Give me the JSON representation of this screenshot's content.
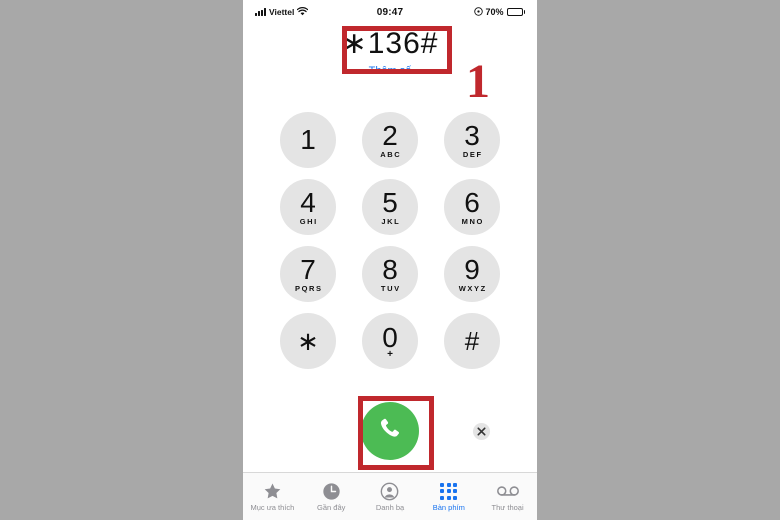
{
  "status_bar": {
    "carrier": "Viettel",
    "time": "09:47",
    "battery_percent": "70%",
    "signal_icon": "signal-bars-icon",
    "wifi_icon": "wifi-icon",
    "alarm_icon": "alarm-icon",
    "battery_icon": "battery-icon"
  },
  "dialer": {
    "number": "∗136#",
    "add_number_label": "Thêm số",
    "keys": [
      {
        "digit": "1",
        "letters": ""
      },
      {
        "digit": "2",
        "letters": "ABC"
      },
      {
        "digit": "3",
        "letters": "DEF"
      },
      {
        "digit": "4",
        "letters": "GHI"
      },
      {
        "digit": "5",
        "letters": "JKL"
      },
      {
        "digit": "6",
        "letters": "MNO"
      },
      {
        "digit": "7",
        "letters": "PQRS"
      },
      {
        "digit": "8",
        "letters": "TUV"
      },
      {
        "digit": "9",
        "letters": "WXYZ"
      },
      {
        "digit": "∗",
        "letters": ""
      },
      {
        "digit": "0",
        "letters": "+"
      },
      {
        "digit": "#",
        "letters": ""
      }
    ],
    "call_button_icon": "phone-handset-icon",
    "delete_button_icon": "delete-x-icon"
  },
  "tab_bar": {
    "tabs": [
      {
        "label": "Mục ưa thích",
        "icon": "star-icon",
        "active": false
      },
      {
        "label": "Gần đây",
        "icon": "clock-icon",
        "active": false
      },
      {
        "label": "Danh bạ",
        "icon": "person-circle-icon",
        "active": false
      },
      {
        "label": "Bàn phím",
        "icon": "keypad-dots-icon",
        "active": true
      },
      {
        "label": "Thư thoại",
        "icon": "voicemail-icon",
        "active": false
      }
    ]
  },
  "annotations": {
    "step_number": "1",
    "highlight_number_field": "red-box-around-number",
    "highlight_call_button": "red-box-around-call-button"
  },
  "colors": {
    "page_background": "#a8a8a8",
    "phone_background": "#ffffff",
    "key_fill": "#e4e4e4",
    "call_green": "#4cbb54",
    "annotation_red": "#c0282d",
    "ios_blue": "#1a74ef",
    "tab_inactive": "#8e8e93"
  }
}
